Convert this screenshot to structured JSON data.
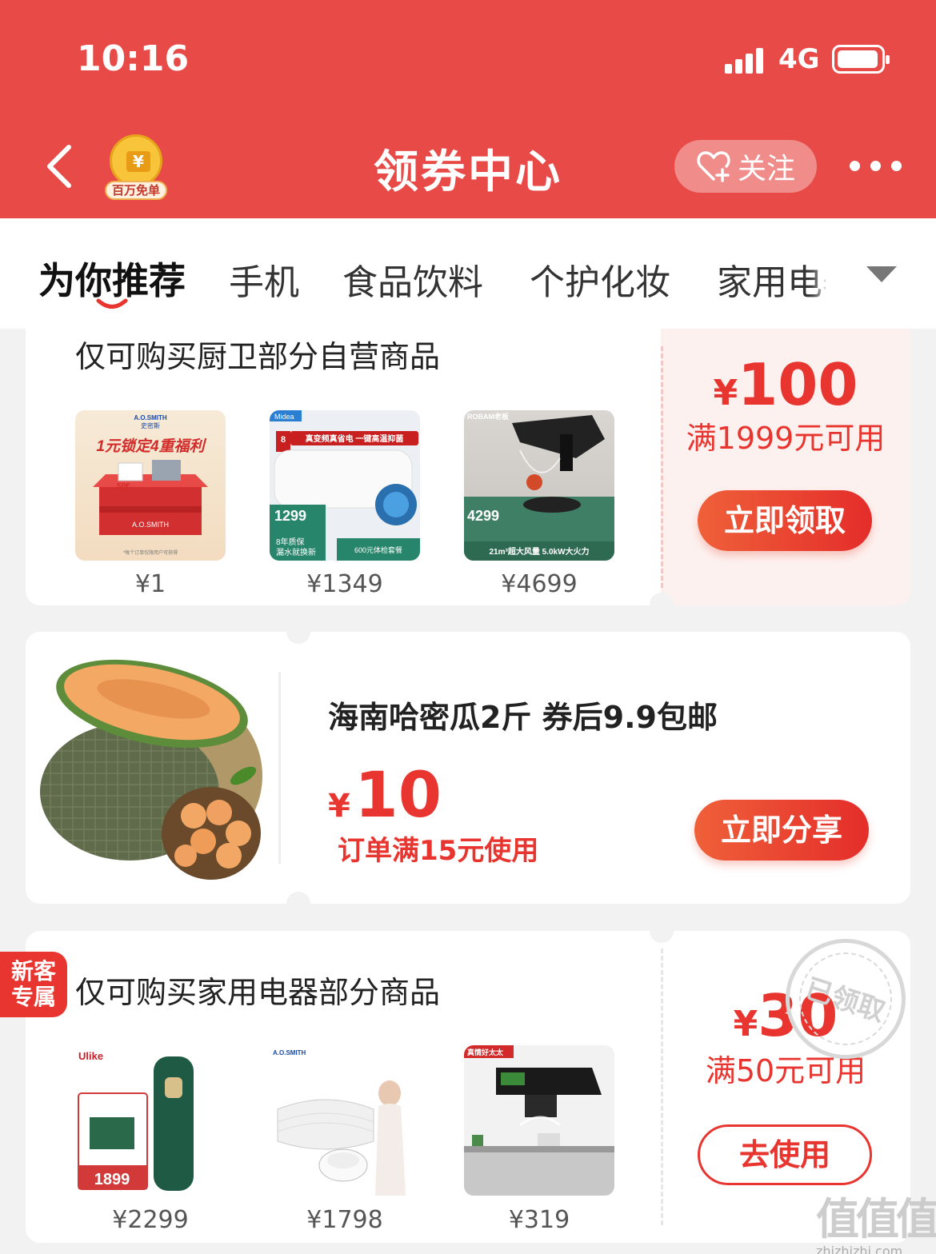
{
  "status_bar": {
    "time": "10:16",
    "network": "4G"
  },
  "header": {
    "title": "领券中心",
    "badge_label": "百万免单",
    "follow_label": "关注"
  },
  "tabs": [
    {
      "label": "为你推荐",
      "active": true
    },
    {
      "label": "手机"
    },
    {
      "label": "食品饮料"
    },
    {
      "label": "个护化妆"
    },
    {
      "label": "家用电器"
    }
  ],
  "coupons": [
    {
      "title": "仅可购买厨卫部分自营商品",
      "products": [
        {
          "price": "¥1",
          "image": "A.O.SMITH 1元锁定4重福利"
        },
        {
          "price": "¥1349",
          "image": "Midea 真变频真省电 1299"
        },
        {
          "price": "¥4699",
          "image": "ROBAM老板 4299 21m³超大风量 5.0kW大火力"
        }
      ],
      "yen": "¥",
      "amount": "100",
      "condition": "满1999元可用",
      "button": "立即领取"
    },
    {
      "title": "海南哈密瓜2斤 券后9.9包邮",
      "yen": "¥",
      "amount": "10",
      "condition": "订单满15元使用",
      "button": "立即分享"
    },
    {
      "tag": "新客专属",
      "title": "仅可购买家用电器部分商品",
      "products": [
        {
          "price": "¥2299",
          "image": "Ulike 1899"
        },
        {
          "price": "¥1798",
          "image": "A.O.SMITH"
        },
        {
          "price": "¥319",
          "image": "真情好太太"
        }
      ],
      "yen": "¥",
      "amount": "30",
      "condition": "满50元可用",
      "button": "去使用",
      "stamp": "已领取"
    }
  ],
  "watermark": {
    "logo": "值值值",
    "url": "zhizhizhi.com"
  },
  "colors": {
    "brand_red": "#e84a48",
    "coupon_red": "#e8352f"
  }
}
